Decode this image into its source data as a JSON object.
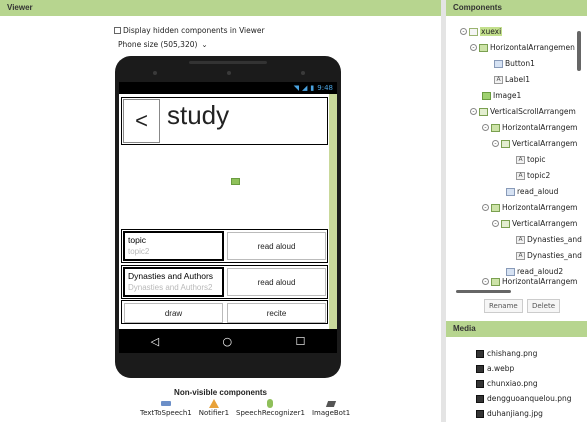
{
  "viewer": {
    "title": "Viewer",
    "checkbox_label": "Display hidden components in Viewer",
    "phone_size": "Phone size (505,320)",
    "status_time": "9:48",
    "back_button": "<",
    "title_label": "study",
    "row1": {
      "text": "topic",
      "hint": "topic2",
      "button": "read aloud"
    },
    "row2": {
      "text": "Dynasties and Authors",
      "hint": "Dynasties and Authors2",
      "button": "read aloud"
    },
    "row3": {
      "left_button": "draw",
      "right_button": "recite"
    },
    "nav": {
      "back": "◁",
      "home": "○",
      "recent": "☐"
    },
    "nonvisible_title": "Non-visible components",
    "nonvisible": [
      "TextToSpeech1",
      "Notifier1",
      "SpeechRecognizer1",
      "ImageBot1"
    ]
  },
  "components": {
    "title": "Components",
    "tree": [
      {
        "label": "xuexi",
        "icon": "screen-icon",
        "toggle": "⊟"
      },
      {
        "label": "HorizontalArrangemen",
        "icon": "horizontal-arrangement-icon",
        "toggle": "⊟"
      },
      {
        "label": "Button1",
        "icon": "button-icon",
        "toggle": ""
      },
      {
        "label": "Label1",
        "icon": "label-icon",
        "toggle": ""
      },
      {
        "label": "Image1",
        "icon": "image-icon",
        "toggle": ""
      },
      {
        "label": "VerticalScrollArrangem",
        "icon": "vertical-arrangement-icon",
        "toggle": "⊟"
      },
      {
        "label": "HorizontalArrangem",
        "icon": "horizontal-arrangement-icon",
        "toggle": "⊟"
      },
      {
        "label": "VerticalArrangem",
        "icon": "vertical-arrangement-icon",
        "toggle": "⊟"
      },
      {
        "label": "topic",
        "icon": "label-icon",
        "toggle": ""
      },
      {
        "label": "topic2",
        "icon": "label-icon",
        "toggle": ""
      },
      {
        "label": "read_aloud",
        "icon": "button-icon",
        "toggle": ""
      },
      {
        "label": "HorizontalArrangem",
        "icon": "horizontal-arrangement-icon",
        "toggle": "⊟"
      },
      {
        "label": "VerticalArrangem",
        "icon": "vertical-arrangement-icon",
        "toggle": "⊟"
      },
      {
        "label": "Dynasties_and",
        "icon": "label-icon",
        "toggle": ""
      },
      {
        "label": "Dynasties_and",
        "icon": "label-icon",
        "toggle": ""
      },
      {
        "label": "read_aloud2",
        "icon": "button-icon",
        "toggle": ""
      },
      {
        "label": "HorizontalArrangem",
        "icon": "horizontal-arrangement-icon",
        "toggle": "⊟"
      }
    ],
    "rename_button": "Rename",
    "delete_button": "Delete"
  },
  "media": {
    "title": "Media",
    "files": [
      "chishang.png",
      "a.webp",
      "chunxiao.png",
      "dengguoanquelou.png",
      "duhanjiang.jpg"
    ]
  }
}
